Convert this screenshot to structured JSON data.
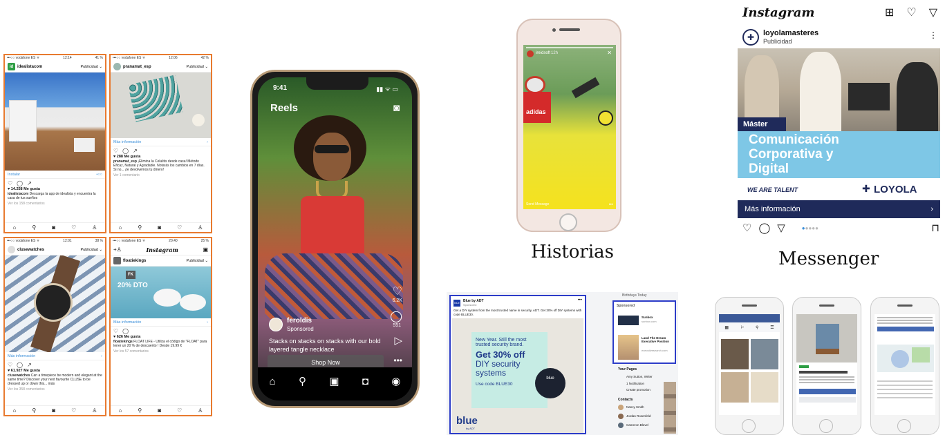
{
  "feed": {
    "card1": {
      "status_left": "•••○○ vodafone ES ᯤ",
      "status_time": "12:14",
      "status_right": "41 %",
      "avatar": "id",
      "account": "idealistacom",
      "sponsor_label": "Publicidad ⌄",
      "cta": "Instalar",
      "likes": "♥ 14.258 Me gusta",
      "caption_user": "idealistacom",
      "caption_text": " Descarga la app de idealista y encuentra la casa de tus sueños",
      "comments": "Ver los 158 comentarios"
    },
    "card2": {
      "status_left": "•••○○ vodafone ES ᯤ",
      "status_time": "12:06",
      "status_right": "42 %",
      "account": "pranamat_esp",
      "sponsor_label": "Publicidad ⌄",
      "cta": "Más información",
      "likes": "♥ 288 Me gusta",
      "caption_user": "pranamat_esp",
      "caption_text": " ¡Elimina la Celulitis desde casa! Método Eficaz, Natural y Agradable. Notarás los cambios en 7 días. Si no... ¡te devolvemos tu dinero!",
      "comments": "Ver 1 comentario"
    },
    "card3": {
      "status_left": "•••○○ vodafone ES ᯤ",
      "status_time": "12:01",
      "status_right": "38 %",
      "account": "clusewatches",
      "sponsor_label": "Publicidad ⌄",
      "cta": "Más información",
      "likes": "♥ 61.927 Me gusta",
      "caption_user": "clusewatches",
      "caption_text": " Can a timepiece be modern and elegant at the same time? Discover your next favourite CLUSE to be dressed up or down this... más",
      "comments": "Ver los 358 comentarios"
    },
    "card4": {
      "status_left": "•••○○ vodafone ES ᯤ",
      "status_time": "20:40",
      "status_right": "25 %",
      "logo": "Instagram",
      "account": "floatiekings",
      "sponsor_label": "Publicidad ⌄",
      "badge_fk": "FK",
      "discount": "20% DTO",
      "cta": "Más información",
      "likes": "♥ 626 Me gusta",
      "caption_user": "floatiekings",
      "caption_text": " FLOAT LIFE - Utiliza el código de \"FLOAT\" para tener un 20 % de descuento ! Desde 19.99 €",
      "comments": "Ver los 57 comentarios"
    }
  },
  "reels": {
    "time": "9:41",
    "title": "Reels",
    "account": "feroldis",
    "sponsored": "Sponsored",
    "caption": "Stacks on stacks on stacks with our bold layered tangle necklace",
    "button": "Shop Now",
    "like_count": "6.2K",
    "comment_count": "551"
  },
  "stories": {
    "account": "ireidsoft",
    "age": "12h",
    "send_message": "Send Message",
    "brand_text": "adidas",
    "label": "Historias"
  },
  "instagram_post": {
    "logo": "Instagram",
    "account": "loyolamasteres",
    "sponsored": "Publicidad",
    "badge": "Máster",
    "headline_line1": "Comunicación",
    "headline_line2": "Corporativa y",
    "headline_line3": "Digital",
    "tagline": "WE ARE TALENT",
    "brand": "LOYOLA",
    "cta": "Más información",
    "label": "Messenger"
  },
  "facebook_desktop": {
    "advertiser": "Blue by ADT",
    "sponsored": "Sponsored",
    "post_text": "Get a DIY system from the most trusted name in security, ADT. Get 30% off DIY systems with code BLUE30.",
    "ad_line1": "New Year. Still the most",
    "ad_line2": "trusted security brand.",
    "ad_offer1": "Get 30% off",
    "ad_offer2": "DIY security",
    "ad_offer3": "systems",
    "ad_code": "Use code BLUE30",
    "brand": "blue",
    "brand_sub": "by ADT",
    "device_text": "blue",
    "birthdays": "Birthdays Today",
    "sponsored_header": "Sponsored",
    "side_ad1_title": "Sunbox",
    "side_ad1_sub": "sunbox.com",
    "side_ad2_title": "Land The Dream Executive Position",
    "side_ad2_sub": "executivesearch.com",
    "your_pages": "Your Pages",
    "page1": "Amy Sutton, Writer",
    "page2": "1 Notification",
    "page3": "Create promotion",
    "contacts": "Contacts",
    "contact1": "Nancy Smith",
    "contact2": "Jordan Rosenfeld",
    "contact3": "Cameron Blevel"
  },
  "colors": {
    "feed_border": "#e87a2f",
    "fb_blue": "#2c3cc8",
    "loyola_navy": "#1f2a5a",
    "loyola_sky": "#7ec7e6"
  }
}
